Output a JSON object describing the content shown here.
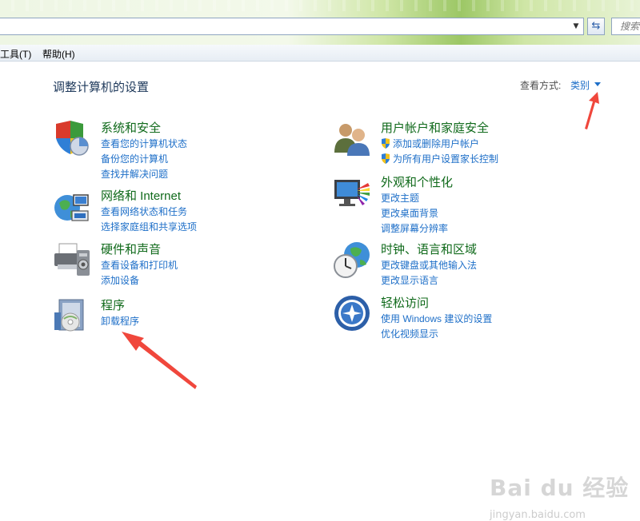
{
  "toolbar": {
    "search_placeholder": "搜索"
  },
  "menubar": {
    "items": [
      "工具(T)",
      "帮助(H)"
    ]
  },
  "main": {
    "title": "调整计算机的设置",
    "view_by_label": "查看方式:",
    "view_by_value": "类别"
  },
  "categories": [
    {
      "title": "系统和安全",
      "icon": "shield-icon",
      "links": [
        "查看您的计算机状态",
        "备份您的计算机",
        "查找并解决问题"
      ]
    },
    {
      "title": "网络和 Internet",
      "icon": "network-globe-icon",
      "links": [
        "查看网络状态和任务",
        "选择家庭组和共享选项"
      ]
    },
    {
      "title": "硬件和声音",
      "icon": "printer-icon",
      "links": [
        "查看设备和打印机",
        "添加设备"
      ]
    },
    {
      "title": "程序",
      "icon": "programs-icon",
      "links": [
        "卸载程序"
      ]
    },
    {
      "title": "用户帐户和家庭安全",
      "icon": "users-icon",
      "links": [
        "添加或删除用户帐户",
        "为所有用户设置家长控制"
      ]
    },
    {
      "title": "外观和个性化",
      "icon": "monitor-palette-icon",
      "links": [
        "更改主题",
        "更改桌面背景",
        "调整屏幕分辨率"
      ]
    },
    {
      "title": "时钟、语言和区域",
      "icon": "clock-globe-icon",
      "links": [
        "更改键盘或其他输入法",
        "更改显示语言"
      ]
    },
    {
      "title": "轻松访问",
      "icon": "ease-of-access-icon",
      "links": [
        "使用 Windows 建议的设置",
        "优化视频显示"
      ]
    }
  ],
  "watermark": {
    "logo": "Bai du 经验",
    "url": "jingyan.baidu.com"
  },
  "colors": {
    "category_title": "#106a1b",
    "link": "#1e6fc8",
    "annotation_arrow": "#f0473c"
  }
}
